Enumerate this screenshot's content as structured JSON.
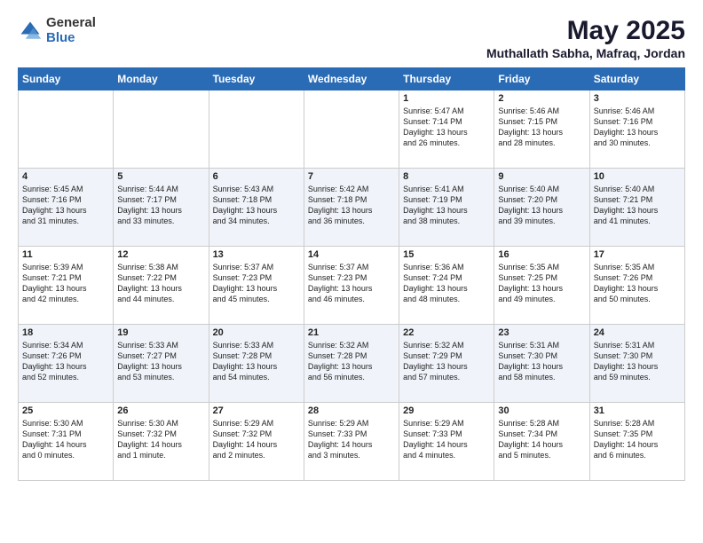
{
  "header": {
    "logo_general": "General",
    "logo_blue": "Blue",
    "title": "May 2025",
    "subtitle": "Muthallath Sabha, Mafraq, Jordan"
  },
  "weekdays": [
    "Sunday",
    "Monday",
    "Tuesday",
    "Wednesday",
    "Thursday",
    "Friday",
    "Saturday"
  ],
  "weeks": [
    [
      {
        "day": "",
        "info": ""
      },
      {
        "day": "",
        "info": ""
      },
      {
        "day": "",
        "info": ""
      },
      {
        "day": "",
        "info": ""
      },
      {
        "day": "1",
        "info": "Sunrise: 5:47 AM\nSunset: 7:14 PM\nDaylight: 13 hours\nand 26 minutes."
      },
      {
        "day": "2",
        "info": "Sunrise: 5:46 AM\nSunset: 7:15 PM\nDaylight: 13 hours\nand 28 minutes."
      },
      {
        "day": "3",
        "info": "Sunrise: 5:46 AM\nSunset: 7:16 PM\nDaylight: 13 hours\nand 30 minutes."
      }
    ],
    [
      {
        "day": "4",
        "info": "Sunrise: 5:45 AM\nSunset: 7:16 PM\nDaylight: 13 hours\nand 31 minutes."
      },
      {
        "day": "5",
        "info": "Sunrise: 5:44 AM\nSunset: 7:17 PM\nDaylight: 13 hours\nand 33 minutes."
      },
      {
        "day": "6",
        "info": "Sunrise: 5:43 AM\nSunset: 7:18 PM\nDaylight: 13 hours\nand 34 minutes."
      },
      {
        "day": "7",
        "info": "Sunrise: 5:42 AM\nSunset: 7:18 PM\nDaylight: 13 hours\nand 36 minutes."
      },
      {
        "day": "8",
        "info": "Sunrise: 5:41 AM\nSunset: 7:19 PM\nDaylight: 13 hours\nand 38 minutes."
      },
      {
        "day": "9",
        "info": "Sunrise: 5:40 AM\nSunset: 7:20 PM\nDaylight: 13 hours\nand 39 minutes."
      },
      {
        "day": "10",
        "info": "Sunrise: 5:40 AM\nSunset: 7:21 PM\nDaylight: 13 hours\nand 41 minutes."
      }
    ],
    [
      {
        "day": "11",
        "info": "Sunrise: 5:39 AM\nSunset: 7:21 PM\nDaylight: 13 hours\nand 42 minutes."
      },
      {
        "day": "12",
        "info": "Sunrise: 5:38 AM\nSunset: 7:22 PM\nDaylight: 13 hours\nand 44 minutes."
      },
      {
        "day": "13",
        "info": "Sunrise: 5:37 AM\nSunset: 7:23 PM\nDaylight: 13 hours\nand 45 minutes."
      },
      {
        "day": "14",
        "info": "Sunrise: 5:37 AM\nSunset: 7:23 PM\nDaylight: 13 hours\nand 46 minutes."
      },
      {
        "day": "15",
        "info": "Sunrise: 5:36 AM\nSunset: 7:24 PM\nDaylight: 13 hours\nand 48 minutes."
      },
      {
        "day": "16",
        "info": "Sunrise: 5:35 AM\nSunset: 7:25 PM\nDaylight: 13 hours\nand 49 minutes."
      },
      {
        "day": "17",
        "info": "Sunrise: 5:35 AM\nSunset: 7:26 PM\nDaylight: 13 hours\nand 50 minutes."
      }
    ],
    [
      {
        "day": "18",
        "info": "Sunrise: 5:34 AM\nSunset: 7:26 PM\nDaylight: 13 hours\nand 52 minutes."
      },
      {
        "day": "19",
        "info": "Sunrise: 5:33 AM\nSunset: 7:27 PM\nDaylight: 13 hours\nand 53 minutes."
      },
      {
        "day": "20",
        "info": "Sunrise: 5:33 AM\nSunset: 7:28 PM\nDaylight: 13 hours\nand 54 minutes."
      },
      {
        "day": "21",
        "info": "Sunrise: 5:32 AM\nSunset: 7:28 PM\nDaylight: 13 hours\nand 56 minutes."
      },
      {
        "day": "22",
        "info": "Sunrise: 5:32 AM\nSunset: 7:29 PM\nDaylight: 13 hours\nand 57 minutes."
      },
      {
        "day": "23",
        "info": "Sunrise: 5:31 AM\nSunset: 7:30 PM\nDaylight: 13 hours\nand 58 minutes."
      },
      {
        "day": "24",
        "info": "Sunrise: 5:31 AM\nSunset: 7:30 PM\nDaylight: 13 hours\nand 59 minutes."
      }
    ],
    [
      {
        "day": "25",
        "info": "Sunrise: 5:30 AM\nSunset: 7:31 PM\nDaylight: 14 hours\nand 0 minutes."
      },
      {
        "day": "26",
        "info": "Sunrise: 5:30 AM\nSunset: 7:32 PM\nDaylight: 14 hours\nand 1 minute."
      },
      {
        "day": "27",
        "info": "Sunrise: 5:29 AM\nSunset: 7:32 PM\nDaylight: 14 hours\nand 2 minutes."
      },
      {
        "day": "28",
        "info": "Sunrise: 5:29 AM\nSunset: 7:33 PM\nDaylight: 14 hours\nand 3 minutes."
      },
      {
        "day": "29",
        "info": "Sunrise: 5:29 AM\nSunset: 7:33 PM\nDaylight: 14 hours\nand 4 minutes."
      },
      {
        "day": "30",
        "info": "Sunrise: 5:28 AM\nSunset: 7:34 PM\nDaylight: 14 hours\nand 5 minutes."
      },
      {
        "day": "31",
        "info": "Sunrise: 5:28 AM\nSunset: 7:35 PM\nDaylight: 14 hours\nand 6 minutes."
      }
    ]
  ]
}
